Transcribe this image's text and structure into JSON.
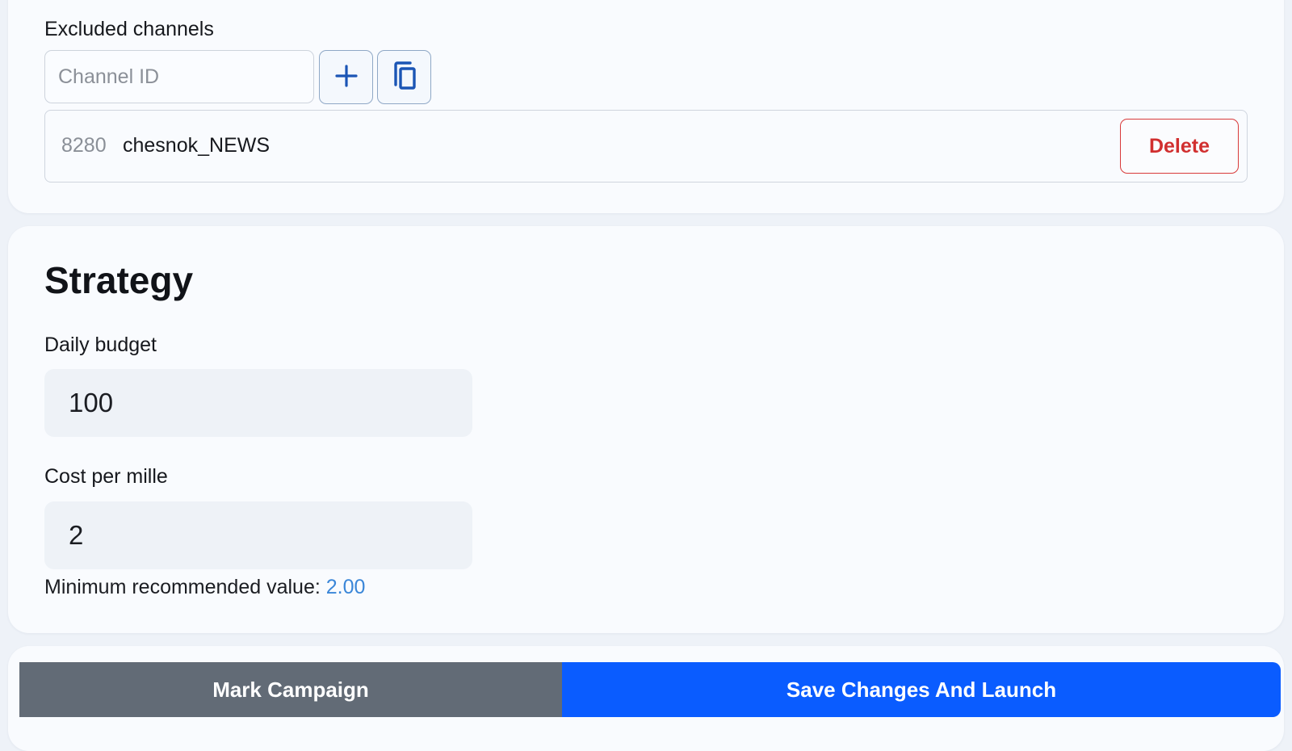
{
  "excluded_channels": {
    "label": "Excluded channels",
    "input_placeholder": "Channel ID",
    "add_icon": "plus-icon",
    "copy_icon": "copy-icon",
    "items": [
      {
        "id": "8280",
        "name": "chesnok_NEWS",
        "delete_label": "Delete"
      }
    ]
  },
  "strategy": {
    "title": "Strategy",
    "daily_budget": {
      "label": "Daily budget",
      "value": "100"
    },
    "cost_per_mille": {
      "label": "Cost per mille",
      "value": "2",
      "hint_text": "Minimum recommended value:",
      "hint_value": "2.00"
    }
  },
  "actions": {
    "mark_label": "Mark Campaign",
    "launch_label": "Save Changes And Launch"
  },
  "colors": {
    "primary": "#0a5cff",
    "secondary": "#626b76",
    "danger": "#d12f2f",
    "link": "#3a86d8",
    "icon": "#1b55b5"
  }
}
